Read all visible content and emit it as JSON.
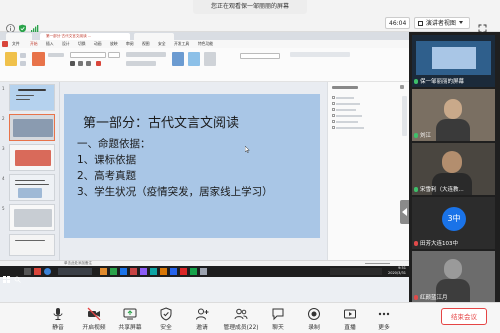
{
  "meeting": {
    "banner": "您正在观看保一邹丽丽的屏幕",
    "timer": "46:04",
    "view_button": "演讲者视图"
  },
  "wps": {
    "tab_title": "第一部分·古代文言文阅读 ...",
    "menu": [
      "文件",
      "开始",
      "插入",
      "设计",
      "切换",
      "动画",
      "放映",
      "审阅",
      "视图",
      "安全",
      "开发工具",
      "特色功能"
    ],
    "active_menu_index": 1,
    "slide_numbers": [
      "1",
      "2",
      "3",
      "4",
      "5"
    ],
    "slide": {
      "title": "第一部分：古代文言文阅读",
      "lines": [
        "一、命题依据：",
        "1、课标依据",
        "2、高考真题",
        "3、学生状况（疫情突发，居家线上学习）"
      ]
    },
    "status": "单击此处添加备注",
    "clock": [
      "9:51",
      "2020/3/31"
    ]
  },
  "participants": [
    {
      "name": "保一邹丽丽的屏幕",
      "mic_color": "#3ec06a",
      "video": "screen"
    },
    {
      "name": "刘江",
      "mic_color": "#3ec06a",
      "video": "person-light"
    },
    {
      "name": "宋雪利（大连教...",
      "mic_color": "#3ec06a",
      "video": "person-dark"
    },
    {
      "name": "田芳大连103中",
      "mic_color": "#e04a4a",
      "video": "avatar",
      "avatar_text": "3中"
    },
    {
      "name": "红颜蓝江月",
      "mic_color": "#e04a4a",
      "video": "person-gray"
    }
  ],
  "toolbar": {
    "items": [
      {
        "label": "静音",
        "icon": "microphone-icon"
      },
      {
        "label": "开启视频",
        "icon": "camera-off-icon"
      },
      {
        "label": "共享屏幕",
        "icon": "share-screen-icon"
      },
      {
        "label": "安全",
        "icon": "shield-icon"
      },
      {
        "label": "邀请",
        "icon": "invite-icon"
      },
      {
        "label": "管理成员(22)",
        "icon": "members-icon"
      },
      {
        "label": "聊天",
        "icon": "chat-icon"
      },
      {
        "label": "录制",
        "icon": "record-icon"
      },
      {
        "label": "直播",
        "icon": "live-icon"
      },
      {
        "label": "更多",
        "icon": "more-icon"
      }
    ],
    "end_label": "结束会议"
  },
  "colors": {
    "accent": "#1a73e8",
    "danger": "#e54545",
    "slide_bg": "#a9c6e6",
    "wps_red": "#c0392b"
  }
}
